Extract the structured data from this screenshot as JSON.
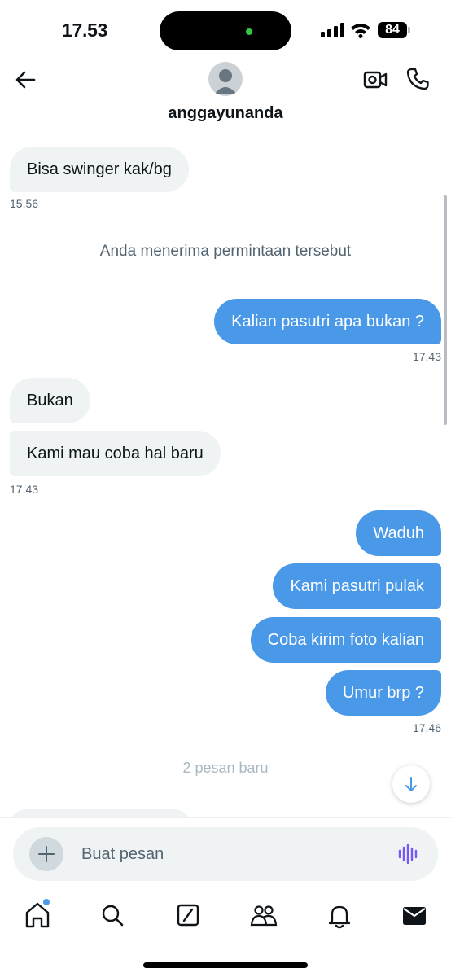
{
  "status_bar": {
    "time": "17.53",
    "battery": "84"
  },
  "header": {
    "contact_name": "anggayunanda"
  },
  "messages": [
    {
      "side": "in",
      "text": "Bisa swinger kak/bg"
    },
    {
      "side": "in",
      "text": "Bukan"
    },
    {
      "side": "in",
      "text": "Kami mau coba hal baru"
    },
    {
      "side": "out",
      "text": "Kalian pasutri apa bukan ?"
    },
    {
      "side": "out",
      "text": "Waduh"
    },
    {
      "side": "out",
      "text": "Kami pasutri pulak"
    },
    {
      "side": "out",
      "text": "Coba kirim foto kalian"
    },
    {
      "side": "out",
      "text": "Umur brp ?"
    }
  ],
  "timestamps": [
    "15.56",
    "17.43",
    "17.43",
    "17.46"
  ],
  "system_message": "Anda menerima permintaan tersebut",
  "divider": "2 pesan baru",
  "composer": {
    "placeholder": "Buat pesan"
  },
  "icons": {
    "back": "arrow-left-icon",
    "video": "video-camera-icon",
    "call": "phone-icon",
    "attach": "plus-icon",
    "voice": "voice-wave-icon",
    "scroll_down": "arrow-down-icon",
    "tabs": [
      "home-icon",
      "search-icon",
      "grok-icon",
      "communities-icon",
      "bell-icon",
      "mail-icon"
    ]
  },
  "colors": {
    "accent": "#4a99e9",
    "incoming_bubble": "#eff3f4",
    "voice": "#7856ff"
  }
}
